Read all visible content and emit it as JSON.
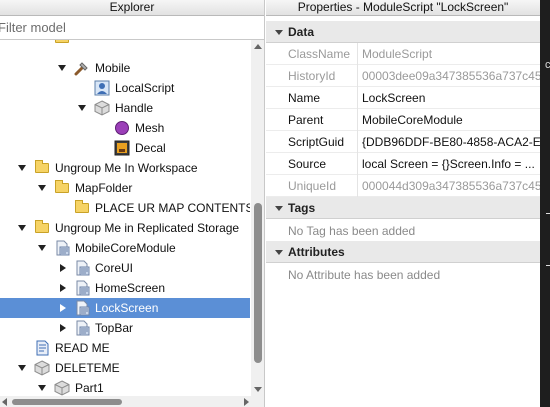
{
  "explorer": {
    "title": "Explorer",
    "filter_placeholder": "Filter model",
    "tree": [
      {
        "label": "",
        "icon": "folder-icon",
        "indent": 1,
        "arrow": "none",
        "partial": true
      },
      {
        "label": "Mobile",
        "icon": "tool-icon",
        "indent": 2,
        "arrow": "down"
      },
      {
        "label": "LocalScript",
        "icon": "localscript-icon",
        "indent": 3,
        "arrow": "none"
      },
      {
        "label": "Handle",
        "icon": "part-icon",
        "indent": 3,
        "arrow": "down"
      },
      {
        "label": "Mesh",
        "icon": "mesh-icon",
        "indent": 4,
        "arrow": "none"
      },
      {
        "label": "Decal",
        "icon": "decal-icon",
        "indent": 4,
        "arrow": "none"
      },
      {
        "label": "Ungroup Me In Workspace",
        "icon": "folder-icon",
        "indent": 0,
        "arrow": "down"
      },
      {
        "label": "MapFolder",
        "icon": "folder-icon",
        "indent": 1,
        "arrow": "down"
      },
      {
        "label": "PLACE UR MAP CONTENTS",
        "icon": "folder-icon",
        "indent": 2,
        "arrow": "none"
      },
      {
        "label": "Ungroup Me in Replicated Storage",
        "icon": "folder-icon",
        "indent": 0,
        "arrow": "down"
      },
      {
        "label": "MobileCoreModule",
        "icon": "modulescript-icon",
        "indent": 1,
        "arrow": "down"
      },
      {
        "label": "CoreUI",
        "icon": "modulescript-icon",
        "indent": 2,
        "arrow": "right"
      },
      {
        "label": "HomeScreen",
        "icon": "modulescript-icon",
        "indent": 2,
        "arrow": "right"
      },
      {
        "label": "LockScreen",
        "icon": "modulescript-icon",
        "indent": 2,
        "arrow": "right",
        "selected": true
      },
      {
        "label": "TopBar",
        "icon": "modulescript-icon",
        "indent": 2,
        "arrow": "right"
      },
      {
        "label": "READ ME",
        "icon": "script-icon",
        "indent": 0,
        "arrow": "none"
      },
      {
        "label": "DELETEME",
        "icon": "model-icon",
        "indent": 0,
        "arrow": "down"
      },
      {
        "label": "Part1",
        "icon": "part-icon",
        "indent": 1,
        "arrow": "down"
      }
    ]
  },
  "properties": {
    "title": "Properties - ModuleScript \"LockScreen\"",
    "sections": {
      "data": "Data",
      "tags": "Tags",
      "attributes": "Attributes"
    },
    "data_rows": [
      {
        "name": "ClassName",
        "value": "ModuleScript",
        "readonly": true
      },
      {
        "name": "HistoryId",
        "value": "00003dee09a347385536a737c45",
        "readonly": true
      },
      {
        "name": "Name",
        "value": "LockScreen",
        "readonly": false
      },
      {
        "name": "Parent",
        "value": "MobileCoreModule",
        "readonly": false
      },
      {
        "name": "ScriptGuid",
        "value": "{DDB96DDF-BE80-4858-ACA2-E",
        "readonly": false
      },
      {
        "name": "Source",
        "value": "local Screen = {}Screen.Info = ...",
        "readonly": false
      },
      {
        "name": "UniqueId",
        "value": "000044d309a347385536a737c45",
        "readonly": true
      }
    ],
    "tags_note": "No Tag has been added",
    "attributes_note": "No Attribute has been added"
  },
  "edge": {
    "char": "c"
  }
}
